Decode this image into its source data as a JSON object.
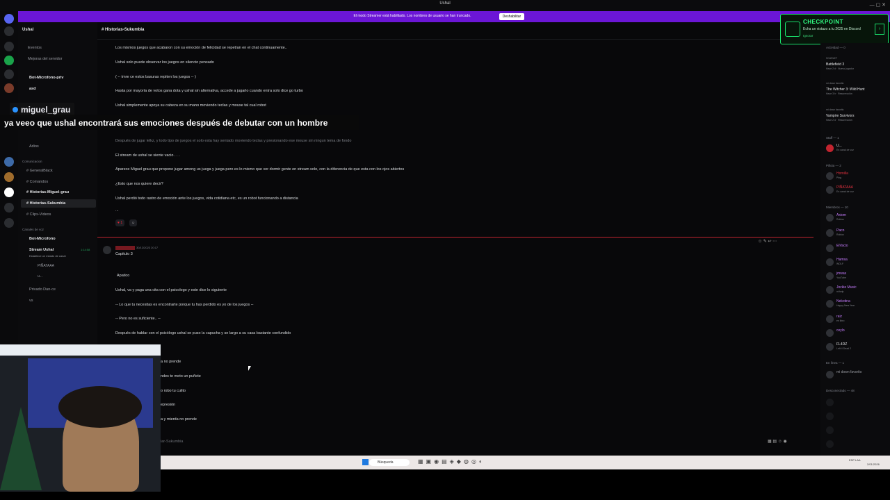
{
  "window": {
    "title": "Ushal"
  },
  "banner": {
    "text": "El modo Streamer está habilitado. Los nombres de usuario se han truncado.",
    "button": "Deshabilitar"
  },
  "server": {
    "name": "Ushal"
  },
  "sidebar": {
    "top_items": [
      "Eventos",
      "Mejoras del servidor"
    ],
    "voice_top": [
      {
        "label": "Bot-Microfono-priv"
      },
      {
        "label": "asd"
      },
      {
        "label": "Adios"
      }
    ],
    "category_comunicacion": "Comunicacion",
    "text_channels": [
      "GeneralBlack",
      "Comandos",
      "Historias-Miguel-grau",
      "Historias-Sukumbia",
      "Clips-Videos"
    ],
    "category_voz": "Canales de voz",
    "voice_channels": [
      "Bot-Microfono",
      "Stream Ushal"
    ],
    "stream_status": "Establece un estado de canal",
    "stream_time": "1:14:58",
    "voice_users": [
      "PIÑATAAA",
      "u..."
    ],
    "bottom_channels": [
      "Privado Dan-ce",
      "vs"
    ]
  },
  "chat": {
    "channel_name": "Historias-Sukumbia",
    "messages_top": [
      "Los mismos juegos que acabaron con su emoción de felicidad se repetían en el chat continuamente..",
      "Ushal solo puede observar los juegos en silencio pensado",
      "( -- tmre ce estos basuras repiten los juegos -- )",
      "Hasta por mayoría de votos gana dota y ushal sin alternativa, accede a jugarlo cuando entra solo dice go turbo",
      "Ushal simplemente apoya su cabeza en su mano moviendo teclas y mouse tal cual robot",
      "Después de jugar lelkz, y todo tipo de juegos el solo esta hay sentado moviendo teclas y presionando ese mouse sin ningun tema de fondo",
      "El stream de ushal se siente vacio . . .",
      "Aparece Miguel grau que propone jugar among us juega y juega pero es lo mismo que ver dormir gente en stream solo, con la diferencia de que esta con los ojos abiertos",
      "¿Esto que nos quiere decir?",
      "Ushal perdió todo rastro de emoción ante los juegos, vida cotidiana etc, es un robot funcionando a distancia",
      "..."
    ],
    "reaction_count": "1",
    "second_msg": {
      "timestamp": "30/12/2023 20:17",
      "title": "Capitulo 3",
      "lines": [
        "Apatico",
        "Ushal, va y paga una cita con el psicologo y este dice lo siguiente",
        "-- Lo que tu necesitas es encontrarte porque tu has perdido es yo de los juegos --",
        "-- Pero no es suficiente.. --",
        "Después de hablar con el psicólogo ushal se puso la capucha y se largo a su casa bastante confundido",
        "a no prende",
        "ndes te meto un puñete",
        "o robo tu culito",
        "epresión",
        "a y mierda no prende"
      ]
    },
    "input_placeholder": "iar-Sukumbia"
  },
  "members": {
    "activity_label": "Actividad — 0",
    "activities": [
      {
        "tag": "SCARLET",
        "game": "Battlefield 3",
        "time": "Hace 2 d · Nuevo jugador"
      },
      {
        "tag": "mi down favorito",
        "game": "The Witcher 3: Wild Hunt",
        "time": "Hace 3 h · Resurrección"
      },
      {
        "tag": "mi down favorito",
        "game": "Vampire Survivors",
        "time": "Hace 2 d · Resurrección"
      }
    ],
    "staff_label": "Staff — 1",
    "staff": [
      {
        "name": "U...",
        "sub": "En canal de voz"
      }
    ],
    "pillota_label": "Pillota — 2",
    "pillota": [
      {
        "name": "Hornilla",
        "sub": "Ping"
      },
      {
        "name": "PIÑATAAA",
        "sub": "En canal de voz"
      }
    ],
    "miembros_label": "Miembros — 10",
    "miembros": [
      {
        "name": "Axiom",
        "sub": "Roblox"
      },
      {
        "name": "Paco",
        "sub": "Roblox"
      },
      {
        "name": "ElVacio",
        "sub": ""
      },
      {
        "name": "Hamsa",
        "sub": "WOLF"
      },
      {
        "name": "jmwas",
        "sub": "YouTube"
      },
      {
        "name": "Jockie Music",
        "sub": "m!help"
      },
      {
        "name": "Nekotina",
        "sub": "Happy New Year"
      },
      {
        "name": "raiz",
        "sub": "en libro"
      },
      {
        "name": "ceylo",
        "sub": ""
      },
      {
        "name": "FL4DZ",
        "sub": "Left 4 Dead 2"
      }
    ],
    "enlinea_label": "En línea — 1",
    "enlinea": [
      {
        "name": "mi down favorito",
        "sub": ""
      }
    ],
    "desconectado_label": "Desconectado — 48"
  },
  "checkpoint": {
    "title": "CHECKPOINT",
    "subtitle": "Echa un vistazo a tu 2025 en Discord",
    "dismiss": "Ignorar"
  },
  "overlay": {
    "username": "miguel_grau",
    "message": "ya veeo que ushal encontrará sus emociones después de debutar con un hombre"
  },
  "taskbar": {
    "search_placeholder": "Búsqueda",
    "lang": "ESP LAA",
    "time": "2/01/2026"
  },
  "colors": {
    "accent": "#6b16d6",
    "checkpoint": "#19e06b",
    "mention": "#e4313f"
  }
}
